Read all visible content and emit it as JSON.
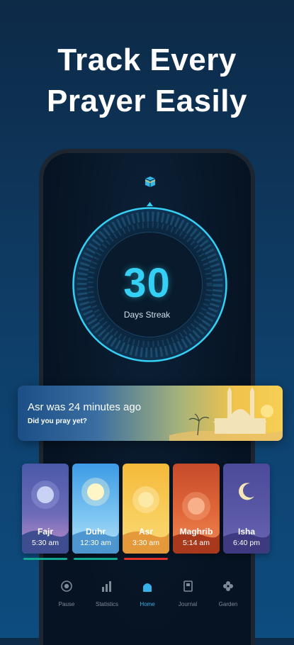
{
  "headline": {
    "line1": "Track Every",
    "line2": "Prayer Easily"
  },
  "streak": {
    "value": "30",
    "label": "Days Streak"
  },
  "banner": {
    "title": "Asr was 24 minutes ago",
    "subtitle": "Did you pray yet?"
  },
  "prayers": [
    {
      "name": "Fajr",
      "time": "5:30 am",
      "bar": "#11a892"
    },
    {
      "name": "Duhr",
      "time": "12:30 am",
      "bar": "#11a892"
    },
    {
      "name": "Asr",
      "time": "3:30 am",
      "bar": "#e0342b"
    },
    {
      "name": "Maghrib",
      "time": "5:14 am",
      "bar": ""
    },
    {
      "name": "Isha",
      "time": "6:40 pm",
      "bar": ""
    }
  ],
  "nav": {
    "items": [
      {
        "label": "Pause",
        "icon": "pause-circle-icon"
      },
      {
        "label": "Statistics",
        "icon": "bar-chart-icon"
      },
      {
        "label": "Home",
        "icon": "mosque-icon",
        "active": true
      },
      {
        "label": "Journal",
        "icon": "journal-icon"
      },
      {
        "label": "Garden",
        "icon": "flower-icon"
      }
    ]
  },
  "colors": {
    "accent": "#35d0f5",
    "done": "#11a892",
    "missed": "#e0342b",
    "nav_active": "#3ab0e8"
  }
}
